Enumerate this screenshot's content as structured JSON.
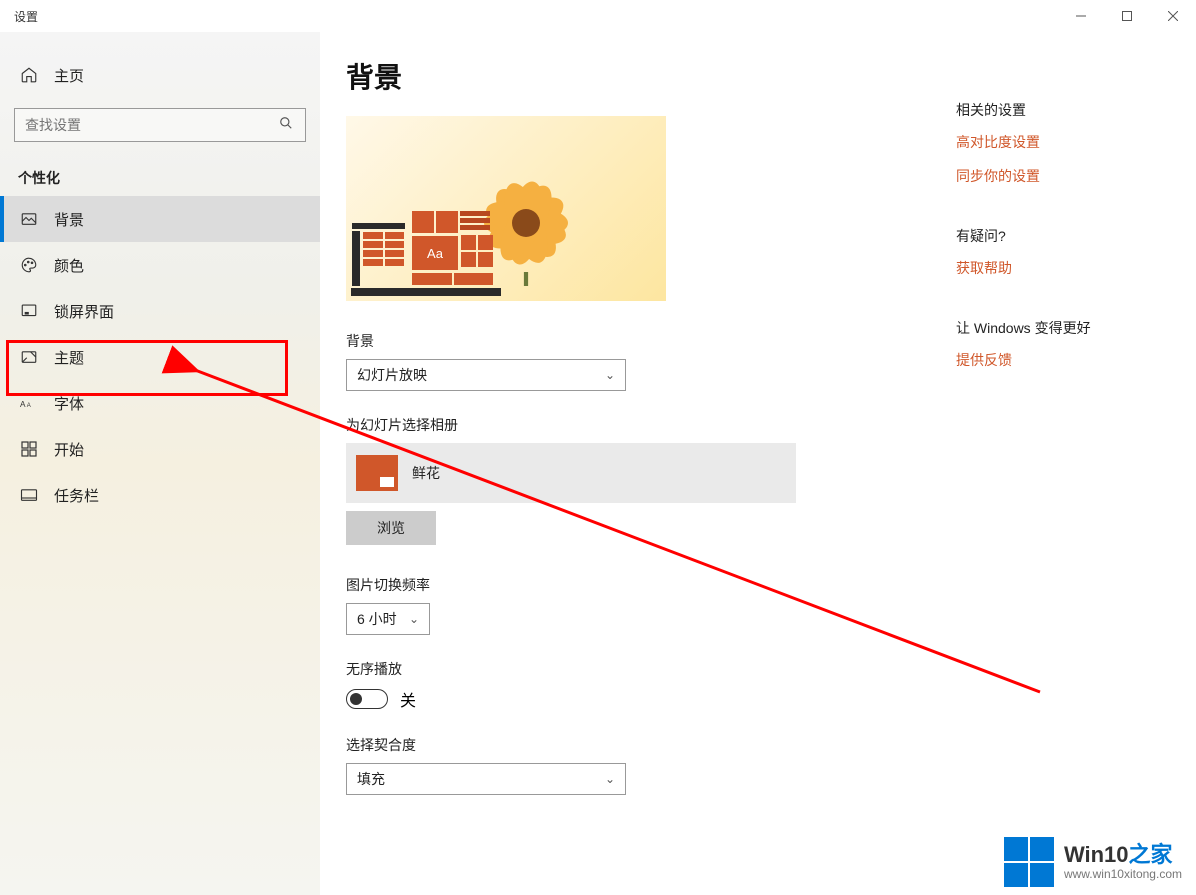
{
  "window": {
    "title": "设置"
  },
  "sidebar": {
    "home": "主页",
    "search_placeholder": "查找设置",
    "section": "个性化",
    "items": [
      {
        "label": "背景"
      },
      {
        "label": "颜色"
      },
      {
        "label": "锁屏界面"
      },
      {
        "label": "主题"
      },
      {
        "label": "字体"
      },
      {
        "label": "开始"
      },
      {
        "label": "任务栏"
      }
    ]
  },
  "main": {
    "title": "背景",
    "preview_tile_text": "Aa",
    "bg_label": "背景",
    "bg_value": "幻灯片放映",
    "album_label": "为幻灯片选择相册",
    "album_name": "鲜花",
    "browse": "浏览",
    "freq_label": "图片切换频率",
    "freq_value": "6 小时",
    "shuffle_label": "无序播放",
    "shuffle_value": "关",
    "fit_label": "选择契合度",
    "fit_value": "填充"
  },
  "rail": {
    "related_heading": "相关的设置",
    "links1": [
      "高对比度设置",
      "同步你的设置"
    ],
    "question_heading": "有疑问?",
    "help_link": "获取帮助",
    "improve_heading": "让 Windows 变得更好",
    "feedback_link": "提供反馈"
  },
  "watermark": {
    "brand1": "Win10",
    "brand2": "之家",
    "url": "www.win10xitong.com"
  }
}
